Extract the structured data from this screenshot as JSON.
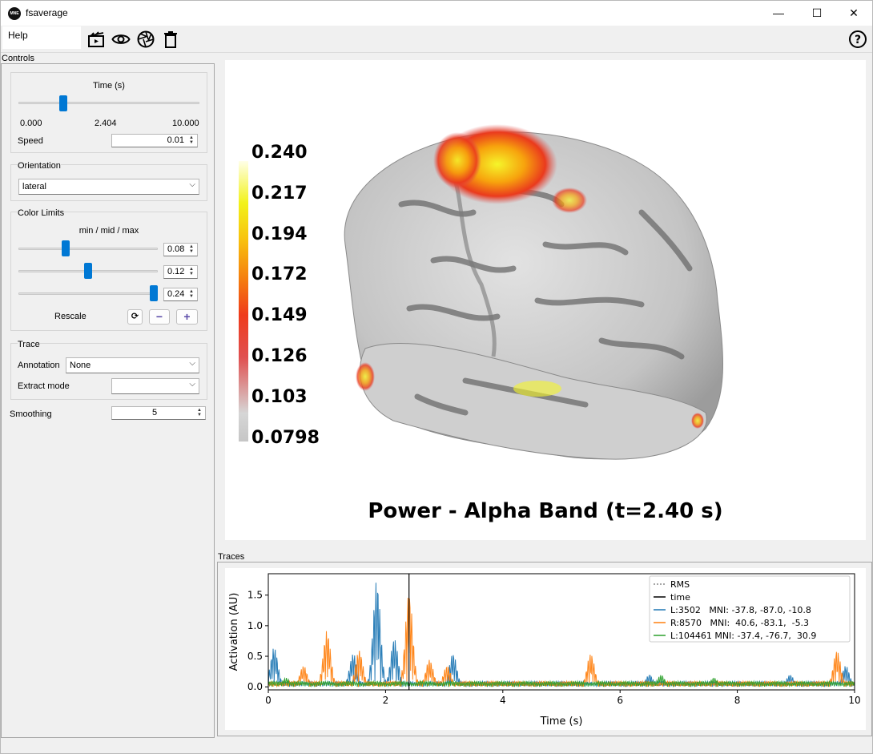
{
  "window": {
    "title": "fsaverage",
    "app_icon_text": "MNE",
    "minimize": "—",
    "maximize": "☐",
    "close": "✕"
  },
  "menu": {
    "help": "Help"
  },
  "toolbar": {
    "movie": "movie-icon",
    "visibility": "eye-icon",
    "screenshot": "camera-shutter-icon",
    "clear": "trash-icon",
    "help": "help-icon"
  },
  "controls": {
    "title": "Controls",
    "time": {
      "label": "Time (s)",
      "min": "0.000",
      "current": "2.404",
      "max": "10.000",
      "fraction": 0.24
    },
    "speed": {
      "label": "Speed",
      "value": "0.01"
    },
    "orientation": {
      "title": "Orientation",
      "value": "lateral"
    },
    "color_limits": {
      "title": "Color Limits",
      "subtitle": "min / mid / max",
      "min": "0.08",
      "mid": "0.12",
      "max": "0.24",
      "min_fraction": 0.33,
      "mid_fraction": 0.5,
      "max_fraction": 1.0,
      "rescale": "Rescale",
      "reset_icon": "⟳",
      "minus": "−",
      "plus": "+"
    },
    "trace": {
      "title": "Trace",
      "annotation_label": "Annotation",
      "annotation_value": "None",
      "extract_label": "Extract mode",
      "extract_value": ""
    },
    "smoothing": {
      "label": "Smoothing",
      "value": "5"
    }
  },
  "view": {
    "title": "Power - Alpha Band (t=2.40 s)",
    "colorbar": [
      "0.240",
      "0.217",
      "0.194",
      "0.172",
      "0.149",
      "0.126",
      "0.103",
      "0.0798"
    ]
  },
  "traces": {
    "title": "Traces",
    "chart_data": {
      "type": "line",
      "xlabel": "Time (s)",
      "ylabel": "Activation (AU)",
      "xlim": [
        0,
        10
      ],
      "ylim": [
        -0.05,
        1.85
      ],
      "xticks": [
        "0",
        "2",
        "4",
        "6",
        "8",
        "10"
      ],
      "yticks": [
        "0.0",
        "0.5",
        "1.0",
        "1.5"
      ],
      "time_marker": 2.4,
      "legend": [
        {
          "name": "RMS",
          "color": "#888888",
          "style": "dotted"
        },
        {
          "name": "time",
          "color": "#000000",
          "style": "solid"
        },
        {
          "name": "L:3502   MNI: -37.8, -87.0, -10.8",
          "color": "#1f77b4",
          "style": "solid"
        },
        {
          "name": "R:8570   MNI:  40.6, -83.1,  -5.3",
          "color": "#ff7f0e",
          "style": "solid"
        },
        {
          "name": "L:104461 MNI: -37.4, -76.7,  30.9",
          "color": "#2ca02c",
          "style": "solid"
        }
      ],
      "series": [
        {
          "name": "L:3502",
          "color": "#1f77b4",
          "peaks": [
            [
              0.1,
              0.65
            ],
            [
              1.45,
              0.55
            ],
            [
              1.85,
              1.75
            ],
            [
              2.15,
              0.8
            ],
            [
              3.15,
              0.55
            ],
            [
              6.5,
              0.2
            ],
            [
              8.9,
              0.2
            ],
            [
              9.85,
              0.35
            ]
          ]
        },
        {
          "name": "R:8570",
          "color": "#ff7f0e",
          "peaks": [
            [
              0.6,
              0.35
            ],
            [
              1.0,
              0.92
            ],
            [
              1.55,
              0.6
            ],
            [
              2.4,
              1.55
            ],
            [
              2.75,
              0.45
            ],
            [
              3.05,
              0.35
            ],
            [
              5.5,
              0.55
            ],
            [
              9.7,
              0.6
            ]
          ]
        },
        {
          "name": "L:104461",
          "color": "#2ca02c",
          "peaks": [
            [
              0.3,
              0.15
            ],
            [
              2.6,
              0.1
            ],
            [
              6.7,
              0.2
            ],
            [
              7.6,
              0.15
            ]
          ]
        }
      ]
    }
  }
}
